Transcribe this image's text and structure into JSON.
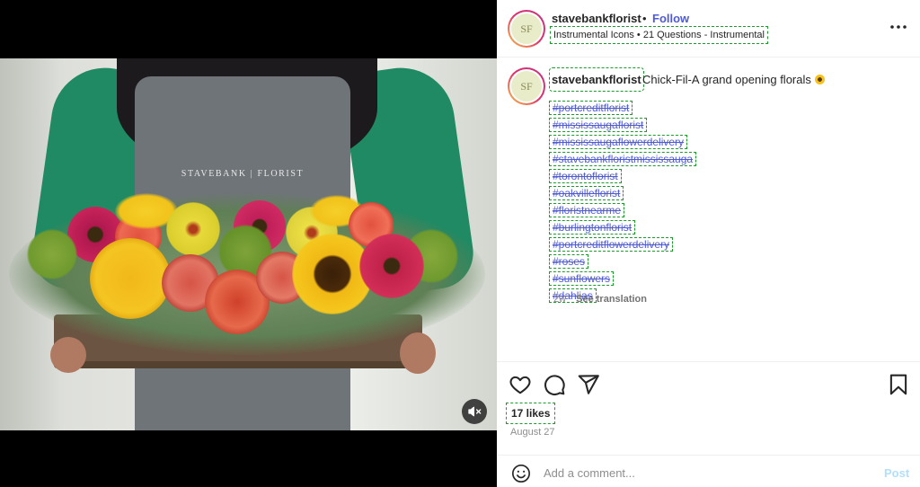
{
  "header": {
    "avatar_initials": "SF",
    "username": "stavebankflorist",
    "separator": "•",
    "follow_label": "Follow",
    "audio": "Instrumental Icons • 21 Questions - Instrumental",
    "more_icon": "more-horizontal-icon"
  },
  "media": {
    "apron_text": "STAVEBANK | FLORIST",
    "mute_icon": "muted-speaker-icon"
  },
  "caption": {
    "avatar_initials": "SF",
    "username": "stavebankflorist",
    "text": "Chick-Fil-A grand opening florals",
    "emoji": "sunflower-emoji",
    "hashtags": [
      "#portcreditflorist",
      "#mississaugaflorist",
      "#mississaugaflowerdelivery",
      "#stavebankfloristmississauga",
      "#torontoflorist",
      "#oakvilleflorist",
      "#floristnearme",
      "#burlingtonflorist",
      "#portcreditflowerdelivery",
      "#roses",
      "#sunflowers",
      "#dahlias"
    ],
    "age": "2w",
    "see_translation": "See translation"
  },
  "actions": {
    "like_icon": "heart-icon",
    "comment_icon": "comment-icon",
    "share_icon": "send-icon",
    "save_icon": "bookmark-icon",
    "likes": "17 likes",
    "date": "August 27"
  },
  "comment_box": {
    "emoji_icon": "smiley-icon",
    "placeholder": "Add a comment...",
    "post_label": "Post"
  },
  "colors": {
    "link": "#4f5bd5",
    "post_disabled": "#b2dffc",
    "annotation_outline": "#1a9c2a"
  }
}
